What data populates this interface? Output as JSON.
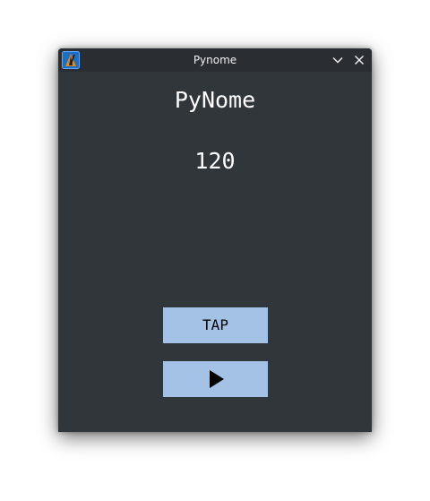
{
  "window": {
    "title": "Pynome"
  },
  "titlebar": {
    "app_icon": "app-logo-icon",
    "minimize_icon": "chevron-down-icon",
    "close_icon": "close-icon"
  },
  "main": {
    "app_name": "PyNome",
    "tempo": "120",
    "tap_label": "TAP",
    "play_icon": "play-icon"
  },
  "colors": {
    "window_bg": "#31363b",
    "titlebar_bg": "#2a2e32",
    "button_bg": "#a3c2e6",
    "text": "#ffffff"
  }
}
